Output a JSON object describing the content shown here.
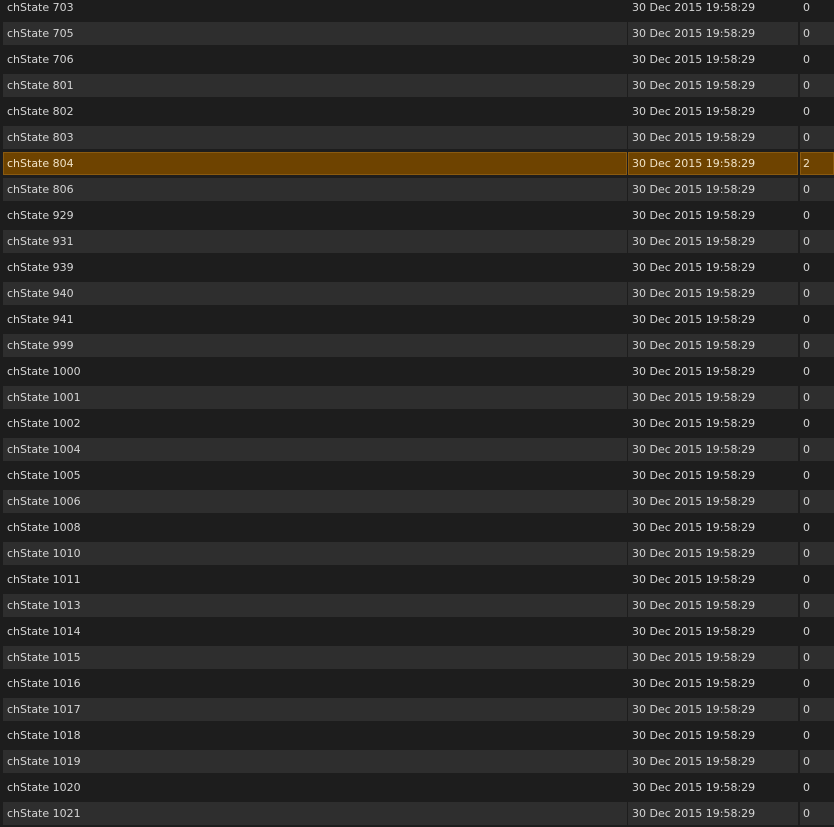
{
  "rows": [
    {
      "name": "chState 703",
      "time": "30 Dec 2015 19:58:29",
      "value": "0",
      "selected": false
    },
    {
      "name": "chState 705",
      "time": "30 Dec 2015 19:58:29",
      "value": "0",
      "selected": false
    },
    {
      "name": "chState 706",
      "time": "30 Dec 2015 19:58:29",
      "value": "0",
      "selected": false
    },
    {
      "name": "chState 801",
      "time": "30 Dec 2015 19:58:29",
      "value": "0",
      "selected": false
    },
    {
      "name": "chState 802",
      "time": "30 Dec 2015 19:58:29",
      "value": "0",
      "selected": false
    },
    {
      "name": "chState 803",
      "time": "30 Dec 2015 19:58:29",
      "value": "0",
      "selected": false
    },
    {
      "name": "chState 804",
      "time": "30 Dec 2015 19:58:29",
      "value": "2",
      "selected": true
    },
    {
      "name": "chState 806",
      "time": "30 Dec 2015 19:58:29",
      "value": "0",
      "selected": false
    },
    {
      "name": "chState 929",
      "time": "30 Dec 2015 19:58:29",
      "value": "0",
      "selected": false
    },
    {
      "name": "chState 931",
      "time": "30 Dec 2015 19:58:29",
      "value": "0",
      "selected": false
    },
    {
      "name": "chState 939",
      "time": "30 Dec 2015 19:58:29",
      "value": "0",
      "selected": false
    },
    {
      "name": "chState 940",
      "time": "30 Dec 2015 19:58:29",
      "value": "0",
      "selected": false
    },
    {
      "name": "chState 941",
      "time": "30 Dec 2015 19:58:29",
      "value": "0",
      "selected": false
    },
    {
      "name": "chState 999",
      "time": "30 Dec 2015 19:58:29",
      "value": "0",
      "selected": false
    },
    {
      "name": "chState 1000",
      "time": "30 Dec 2015 19:58:29",
      "value": "0",
      "selected": false
    },
    {
      "name": "chState 1001",
      "time": "30 Dec 2015 19:58:29",
      "value": "0",
      "selected": false
    },
    {
      "name": "chState 1002",
      "time": "30 Dec 2015 19:58:29",
      "value": "0",
      "selected": false
    },
    {
      "name": "chState 1004",
      "time": "30 Dec 2015 19:58:29",
      "value": "0",
      "selected": false
    },
    {
      "name": "chState 1005",
      "time": "30 Dec 2015 19:58:29",
      "value": "0",
      "selected": false
    },
    {
      "name": "chState 1006",
      "time": "30 Dec 2015 19:58:29",
      "value": "0",
      "selected": false
    },
    {
      "name": "chState 1008",
      "time": "30 Dec 2015 19:58:29",
      "value": "0",
      "selected": false
    },
    {
      "name": "chState 1010",
      "time": "30 Dec 2015 19:58:29",
      "value": "0",
      "selected": false
    },
    {
      "name": "chState 1011",
      "time": "30 Dec 2015 19:58:29",
      "value": "0",
      "selected": false
    },
    {
      "name": "chState 1013",
      "time": "30 Dec 2015 19:58:29",
      "value": "0",
      "selected": false
    },
    {
      "name": "chState 1014",
      "time": "30 Dec 2015 19:58:29",
      "value": "0",
      "selected": false
    },
    {
      "name": "chState 1015",
      "time": "30 Dec 2015 19:58:29",
      "value": "0",
      "selected": false
    },
    {
      "name": "chState 1016",
      "time": "30 Dec 2015 19:58:29",
      "value": "0",
      "selected": false
    },
    {
      "name": "chState 1017",
      "time": "30 Dec 2015 19:58:29",
      "value": "0",
      "selected": false
    },
    {
      "name": "chState 1018",
      "time": "30 Dec 2015 19:58:29",
      "value": "0",
      "selected": false
    },
    {
      "name": "chState 1019",
      "time": "30 Dec 2015 19:58:29",
      "value": "0",
      "selected": false
    },
    {
      "name": "chState 1020",
      "time": "30 Dec 2015 19:58:29",
      "value": "0",
      "selected": false
    },
    {
      "name": "chState 1021",
      "time": "30 Dec 2015 19:58:29",
      "value": "0",
      "selected": false
    }
  ],
  "colors": {
    "background": "#1d1d1d",
    "alt_row": "#2e2e2e",
    "selected_row": "#6e4300",
    "text": "#d4d4d4"
  }
}
